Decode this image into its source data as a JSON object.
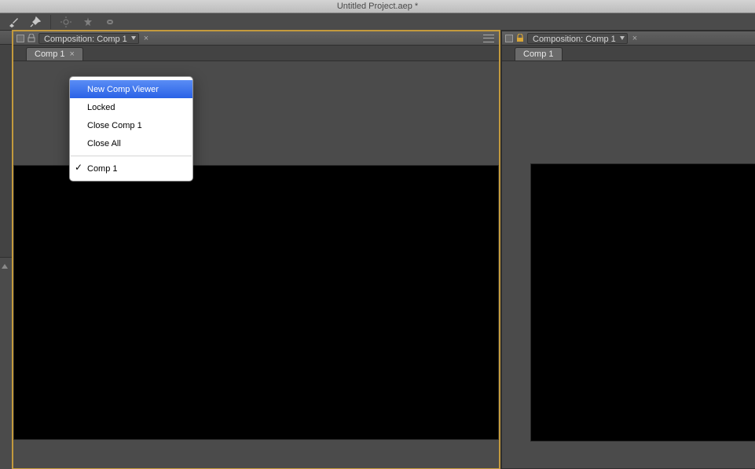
{
  "titlebar": {
    "title": "Untitled Project.aep *"
  },
  "toolbar_icons": {
    "brush": "brush-icon",
    "pin": "pin-icon",
    "sun": "sun-icon",
    "star": "star-icon",
    "link": "link-icon"
  },
  "panel_left": {
    "locked": false,
    "title": "Composition: Comp 1",
    "tab": "Comp 1"
  },
  "panel_right": {
    "locked": true,
    "title": "Composition: Comp 1",
    "tab": "Comp 1"
  },
  "dropdown": {
    "items": [
      {
        "label": "New Comp Viewer",
        "highlight": true
      },
      {
        "label": "Locked"
      },
      {
        "label": "Close Comp 1"
      },
      {
        "label": "Close All"
      }
    ],
    "checked_item": "Comp 1"
  }
}
